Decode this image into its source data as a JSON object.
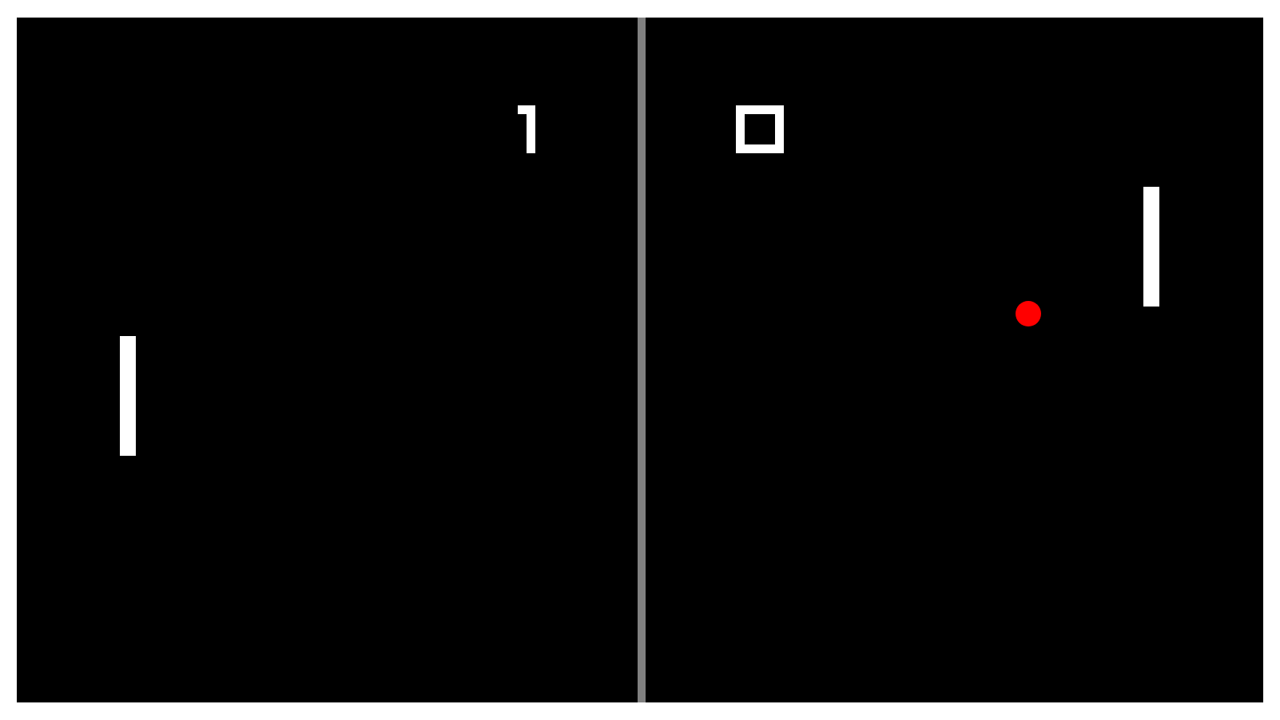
{
  "colors": {
    "frame": "#ffffff",
    "court": "#000000",
    "net": "#808080",
    "paddle": "#ffffff",
    "ball": "#ff0000",
    "digits": "#ffffff"
  },
  "score": {
    "left": "1",
    "right": "0"
  }
}
